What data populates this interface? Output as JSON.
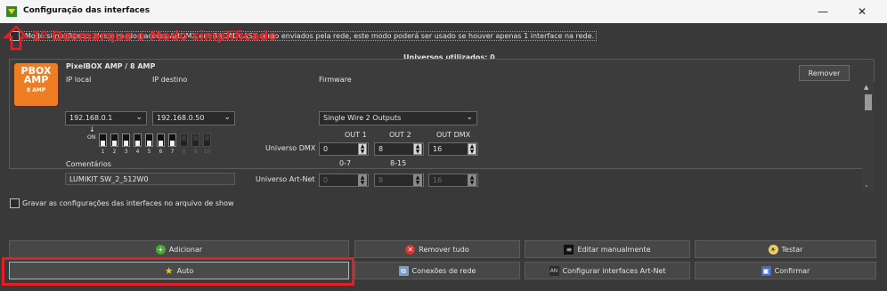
{
  "window": {
    "title": "Configuração das interfaces",
    "minimize": "—",
    "close": "✕"
  },
  "simplified_mode": {
    "label": "Modo simplificado: Neste modo pacotes ArtDMX em BROADCAST serão enviados pela rede, este modo poderá ser usado se houver apenas 1 interface na rede.",
    "checked": false
  },
  "annotation": {
    "text": "1º Desmarque o Modo simplificado",
    "color": "#e8232a"
  },
  "universes_used": "Universos utilizados:  0",
  "interface": {
    "name": "PixelBOX AMP / 8 AMP",
    "logo_lines": [
      "PBOX",
      "AMP",
      "8 AMP"
    ],
    "ip_local_label": "IP local",
    "ip_local_value": "192.168.0.1",
    "ip_destino_label": "IP destino",
    "ip_destino_value": "192.168.0.50",
    "firmware_label": "Firmware",
    "firmware_value": "Single Wire 2 Outputs",
    "remove_button": "Remover",
    "dip_on_label": "ON",
    "dip_arrow": "↓",
    "dip_numbers": [
      "1",
      "2",
      "3",
      "4",
      "5",
      "6",
      "7",
      "8",
      "9",
      "10"
    ],
    "comments_label": "Comentários",
    "comments_value": "LUMIKIT SW_2_512W0",
    "out_headers": [
      "OUT 1",
      "OUT 2",
      "OUT DMX"
    ],
    "universe_dmx_label": "Universo DMX",
    "universe_dmx_values": [
      "0",
      "8",
      "16"
    ],
    "ranges": [
      "0-7",
      "8-15"
    ],
    "artnet_label": "Universo Art-Net",
    "artnet_values": [
      "0",
      "8",
      "16"
    ]
  },
  "save_config_label": "Gravar as configurações das interfaces no arquivo de show",
  "buttons": {
    "add": "Adicionar",
    "remove_all": "Remover tudo",
    "edit_manual": "Editar manualmente",
    "test": "Testar",
    "auto": "Auto",
    "network": "Conexões de rede",
    "artnet_config": "Configurar interfaces Art-Net",
    "confirm": "Confirmar"
  }
}
